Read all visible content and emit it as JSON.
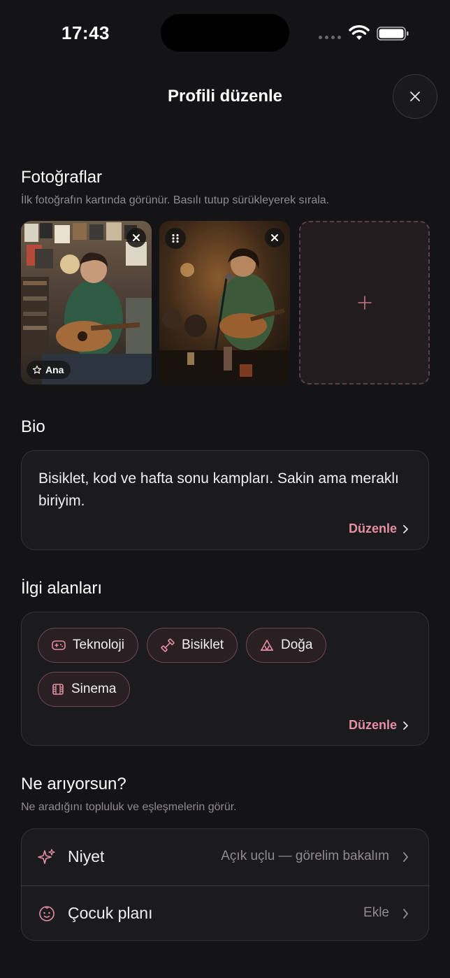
{
  "status": {
    "time": "17:43"
  },
  "header": {
    "title": "Profili düzenle"
  },
  "photos": {
    "title": "Fotoğraflar",
    "subtitle": "İlk fotoğrafın kartında görünür. Basılı tutup sürükleyerek sırala.",
    "main_badge": "Ana",
    "add_symbol": "+"
  },
  "bio": {
    "title": "Bio",
    "text": "Bisiklet, kod ve hafta sonu kampları. Sakin ama meraklı biriyim.",
    "edit": "Düzenle"
  },
  "interests": {
    "title": "İlgi alanları",
    "chips": [
      {
        "label": "Teknoloji",
        "icon": "gamepad-icon"
      },
      {
        "label": "Bisiklet",
        "icon": "dumbbell-icon"
      },
      {
        "label": "Doğa",
        "icon": "tent-icon"
      },
      {
        "label": "Sinema",
        "icon": "film-icon"
      }
    ],
    "edit": "Düzenle"
  },
  "looking": {
    "title": "Ne arıyorsun?",
    "subtitle": "Ne aradığını topluluk ve eşleşmelerin görür.",
    "rows": [
      {
        "label": "Niyet",
        "value": "Açık uçlu — görelim bakalım",
        "icon": "sparkles-icon"
      },
      {
        "label": "Çocuk planı",
        "value": "Ekle",
        "icon": "baby-icon"
      }
    ]
  },
  "colors": {
    "accent": "#e48fa3",
    "background": "#141315",
    "card": "#1b1a1c"
  }
}
